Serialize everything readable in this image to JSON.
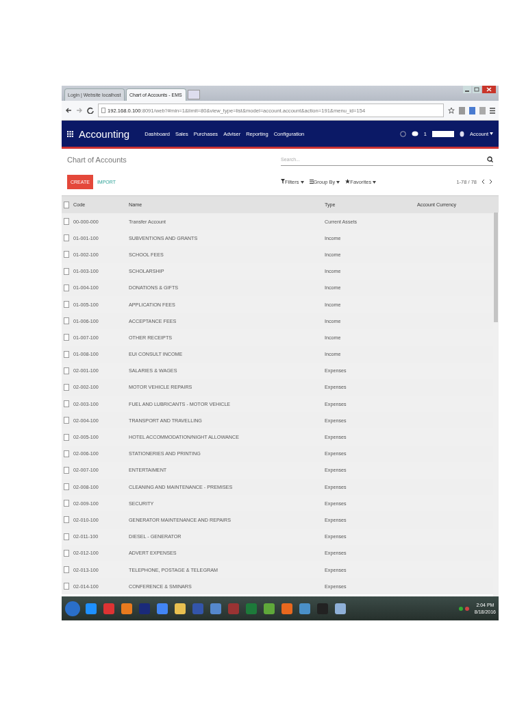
{
  "browser": {
    "tabs": [
      {
        "title": "Login | Website localhost",
        "selected": false
      },
      {
        "title": "Chart of Accounts - EMS",
        "selected": true
      }
    ],
    "url_host": "192.168.0.100",
    "url_rest": ":8091/web?#min=1&limit=80&view_type=list&model=account.account&action=191&menu_id=154"
  },
  "navbar": {
    "app": "Accounting",
    "menu": [
      "Dashboard",
      "Sales",
      "Purchases",
      "Adviser",
      "Reporting",
      "Configuration"
    ],
    "messages_count": "1",
    "account": "Account"
  },
  "control_panel": {
    "breadcrumb": "Chart of Accounts",
    "search": {
      "placeholder": "Search..."
    },
    "create": "CREATE",
    "import": "IMPORT",
    "filters": "Filters",
    "group_by": "Group By",
    "favorites": "Favorites",
    "pager": "1-78 / 78"
  },
  "table": {
    "header_checked": false,
    "columns": [
      "Code",
      "Name",
      "Type",
      "Account Currency"
    ],
    "rows": [
      {
        "code": "00-000-000",
        "name": "Transfer Account",
        "type": "Current Assets",
        "checked": false
      },
      {
        "code": "01-001-100",
        "name": "SUBVENTIONS AND GRANTS",
        "type": "Income",
        "checked": false
      },
      {
        "code": "01-002-100",
        "name": "SCHOOL FEES",
        "type": "Income",
        "checked": false
      },
      {
        "code": "01-003-100",
        "name": "SCHOLARSHIP",
        "type": "Income",
        "checked": false
      },
      {
        "code": "01-004-100",
        "name": "DONATIONS & GIFTS",
        "type": "Income",
        "checked": false
      },
      {
        "code": "01-005-100",
        "name": "APPLICATION FEES",
        "type": "Income",
        "checked": false
      },
      {
        "code": "01-006-100",
        "name": "ACCEPTANCE FEES",
        "type": "Income",
        "checked": false
      },
      {
        "code": "01-007-100",
        "name": "OTHER RECEIPTS",
        "type": "Income",
        "checked": false
      },
      {
        "code": "01-008-100",
        "name": "EUI CONSULT INCOME",
        "type": "Income",
        "checked": false
      },
      {
        "code": "02-001-100",
        "name": "SALARIES & WAGES",
        "type": "Expenses",
        "checked": false
      },
      {
        "code": "02-002-100",
        "name": "MOTOR VEHICLE REPAIRS",
        "type": "Expenses",
        "checked": false
      },
      {
        "code": "02-003-100",
        "name": "FUEL AND LUBRICANTS - MOTOR VEHICLE",
        "type": "Expenses",
        "checked": false
      },
      {
        "code": "02-004-100",
        "name": "TRANSPORT AND TRAVELLING",
        "type": "Expenses",
        "checked": false
      },
      {
        "code": "02-005-100",
        "name": "HOTEL ACCOMMODATION/NIGHT ALLOWANCE",
        "type": "Expenses",
        "checked": false
      },
      {
        "code": "02-006-100",
        "name": "STATIONERIES AND PRINTING",
        "type": "Expenses",
        "checked": false
      },
      {
        "code": "02-007-100",
        "name": "ENTERTAIMENT",
        "type": "Expenses",
        "checked": false
      },
      {
        "code": "02-008-100",
        "name": "CLEANING AND MAINTENANCE - PREMISES",
        "type": "Expenses",
        "checked": false
      },
      {
        "code": "02-009-100",
        "name": "SECURITY",
        "type": "Expenses",
        "checked": false
      },
      {
        "code": "02-010-100",
        "name": "GENERATOR MAINTENANCE AND REPAIRS",
        "type": "Expenses",
        "checked": false
      },
      {
        "code": "02-011-100",
        "name": "DIESEL - GENERATOR",
        "type": "Expenses",
        "checked": false
      },
      {
        "code": "02-012-100",
        "name": "ADVERT EXPENSES",
        "type": "Expenses",
        "checked": false
      },
      {
        "code": "02-013-100",
        "name": "TELEPHONE, POSTAGE & TELEGRAM",
        "type": "Expenses",
        "checked": false
      },
      {
        "code": "02-014-100",
        "name": "CONFERENCE & SMINARS",
        "type": "Expenses",
        "checked": false
      }
    ]
  },
  "taskbar": {
    "time": "2:04 PM",
    "date": "8/18/2016"
  }
}
